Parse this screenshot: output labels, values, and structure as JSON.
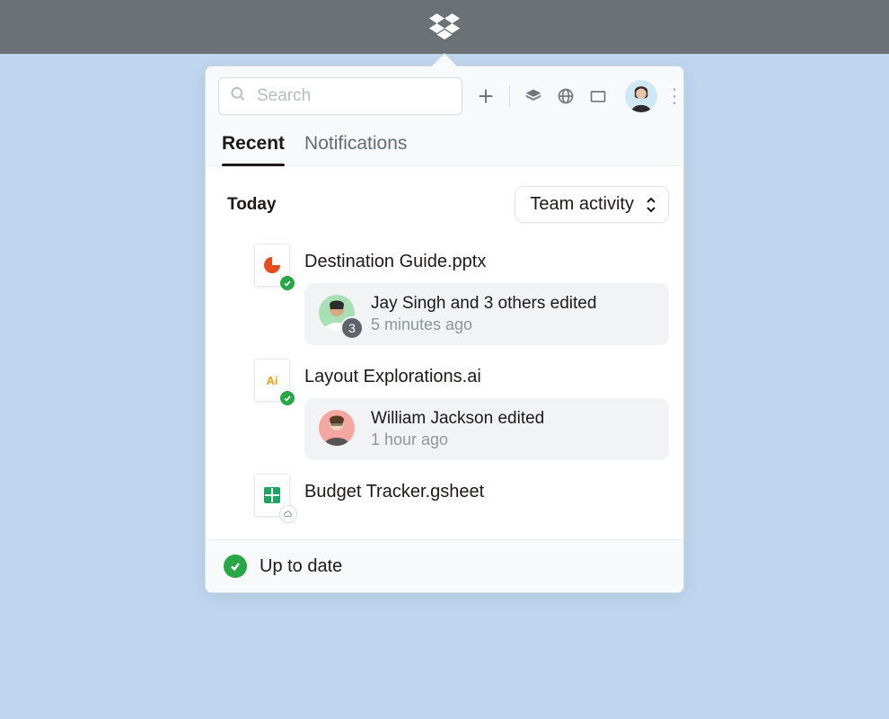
{
  "brand": {
    "name": "Dropbox"
  },
  "search": {
    "placeholder": "Search"
  },
  "tabs": {
    "recent": "Recent",
    "notifications": "Notifications",
    "active": "recent"
  },
  "filter": {
    "label": "Team activity"
  },
  "section": {
    "title": "Today"
  },
  "files": [
    {
      "name": "Destination Guide.pptx",
      "type": "pptx",
      "sync": "synced",
      "activity": {
        "text": "Jay Singh and 3 others edited",
        "time": "5 minutes ago",
        "others_count": "3"
      }
    },
    {
      "name": "Layout Explorations.ai",
      "type": "ai",
      "sync": "synced",
      "activity": {
        "text": "William Jackson edited",
        "time": "1 hour ago"
      }
    },
    {
      "name": "Budget Tracker.gsheet",
      "type": "gsheet",
      "sync": "cloud"
    }
  ],
  "status": {
    "text": "Up to date"
  }
}
